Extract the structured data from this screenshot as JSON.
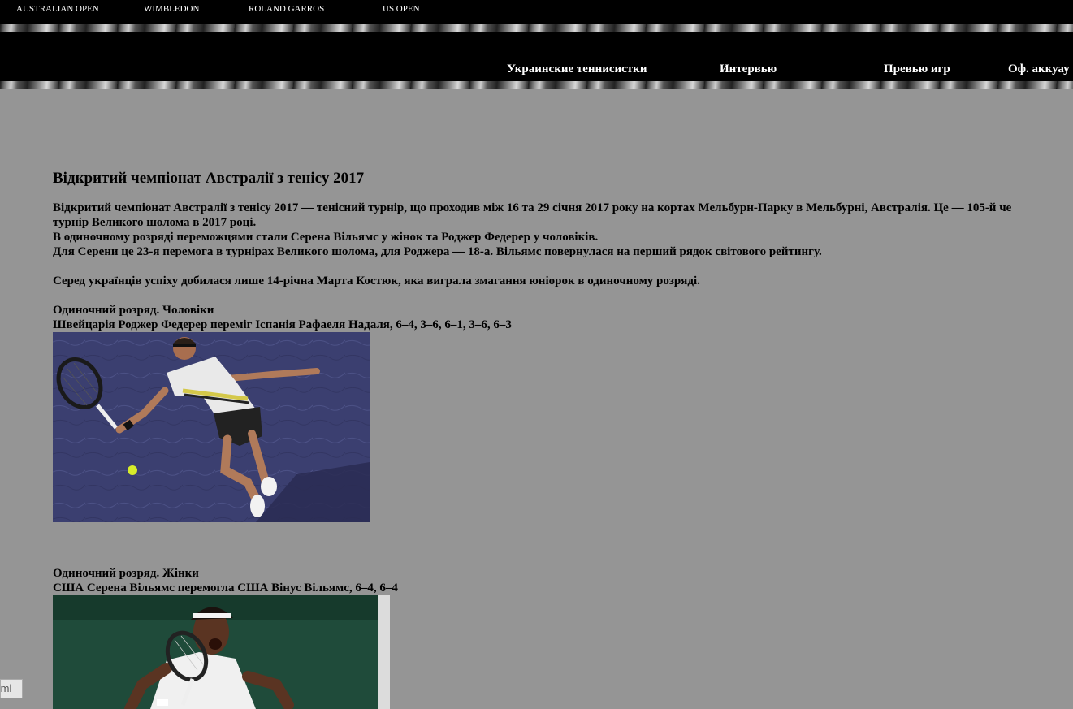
{
  "topnav": {
    "items": [
      "AUSTRALIAN OPEN",
      "WIMBLEDON",
      "ROLAND GARROS",
      "US OPEN"
    ]
  },
  "mainnav": {
    "items": [
      "Украинские теннисистки",
      "Интервью",
      "Превью игр",
      "Оф. аккуау"
    ]
  },
  "article": {
    "title": "Відкритий чемпіонат Австралії з тенісу 2017",
    "intro_line1": "Відкритий чемпіонат Австралії з тенісу 2017 — тенісний турнір, що проходив між 16 та 29 січня 2017 року на кортах Мельбурн-Парку в Мельбурні, Австралія. Це — 105-й че",
    "intro_line2": "турнір Великого шолома в 2017 році.",
    "winners": "В одиночному розряді переможцями стали Серена Вільямс у жінок та Роджер Федерер у чоловіків.",
    "records": "Для Серени це 23-я перемога в турнірах Великого шолома, для Роджера — 18-а. Вільямс повернулася на перший рядок світового рейтингу.",
    "ukraine": "Серед українців успіху добилася лише 14-річна Марта Костюк, яка виграла змагання юніорок в одиночному розряді.",
    "men_heading": "Одиночний розряд. Чоловіки",
    "men_result": "Швейцарія Роджер Федерер переміг Іспанія Рафаеля Надаля, 6–4, 3–6, 6–1, 3–6, 6–3",
    "women_heading": "Одиночний розряд. Жінки",
    "women_result": "США Серена Вільямс перемогла США Вінус Вільямс, 6–4, 6–4"
  },
  "corner_tab": "tml"
}
